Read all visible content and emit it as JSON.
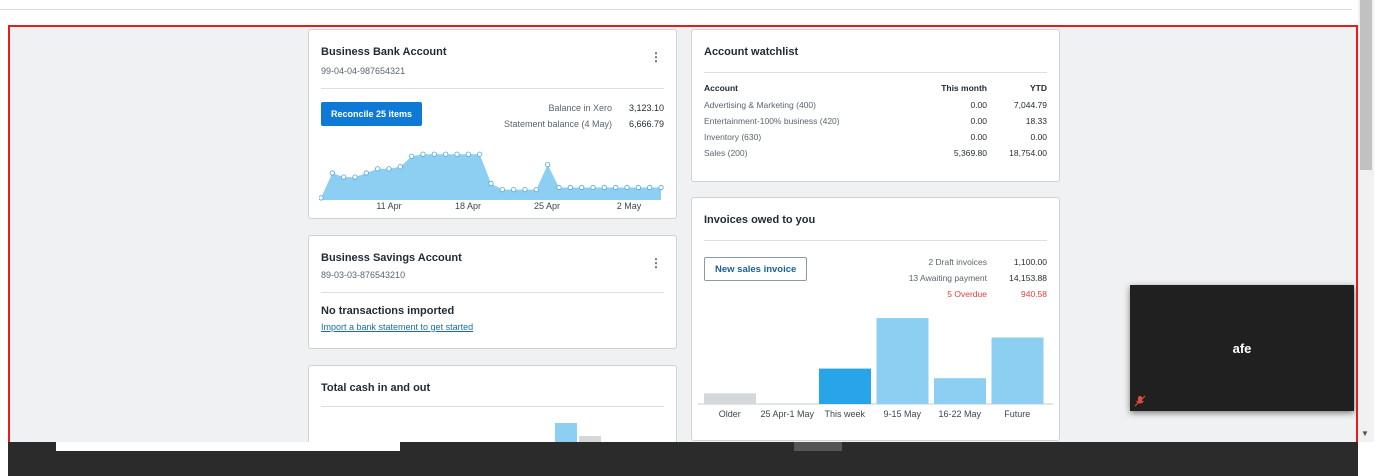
{
  "bank_account": {
    "title": "Business Bank Account",
    "account_number": "99-04-04-987654321",
    "reconcile_label": "Reconcile 25 items",
    "balance_xero_label": "Balance in Xero",
    "balance_xero_value": "3,123.10",
    "statement_label": "Statement balance (4 May)",
    "statement_value": "6,666.79",
    "chart_labels": [
      "11 Apr",
      "18 Apr",
      "25 Apr",
      "2 May"
    ],
    "chart_values": [
      2,
      26,
      22,
      22,
      26,
      30,
      30,
      32,
      42,
      44,
      44,
      44,
      44,
      44,
      44,
      16,
      10,
      10,
      10,
      10,
      34,
      12,
      12,
      12,
      12,
      12,
      12,
      12,
      12,
      12,
      12
    ]
  },
  "savings_account": {
    "title": "Business Savings Account",
    "account_number": "89-03-03-876543210",
    "empty_title": "No transactions imported",
    "empty_link": "Import a bank statement to get started"
  },
  "cash_flow": {
    "title": "Total cash in and out"
  },
  "watchlist": {
    "title": "Account watchlist",
    "columns": [
      "Account",
      "This month",
      "YTD"
    ],
    "rows": [
      {
        "account": "Advertising & Marketing (400)",
        "month": "0.00",
        "ytd": "7,044.79"
      },
      {
        "account": "Entertainment-100% business (420)",
        "month": "0.00",
        "ytd": "18.33"
      },
      {
        "account": "Inventory (630)",
        "month": "0.00",
        "ytd": "0.00"
      },
      {
        "account": "Sales (200)",
        "month": "5,369.80",
        "ytd": "18,754.00"
      }
    ]
  },
  "invoices": {
    "title": "Invoices owed to you",
    "new_invoice_label": "New sales invoice",
    "draft_label": "2 Draft invoices",
    "draft_value": "1,100.00",
    "awaiting_label": "13 Awaiting payment",
    "awaiting_value": "14,153.88",
    "overdue_label": "5 Overdue",
    "overdue_value": "940.58",
    "colors": {
      "older": "#d4d8db",
      "this_week": "#28a4e8",
      "future": "#8ccff2",
      "overdue": "#e0403a"
    },
    "chart_data": {
      "type": "bar",
      "categories": [
        "Older",
        "25 Apr-1 May",
        "This week",
        "9-15 May",
        "16-22 May",
        "Future"
      ],
      "values": [
        10,
        0,
        33,
        80,
        24,
        62
      ],
      "xlabel": "",
      "ylabel": ""
    }
  },
  "video": {
    "name": "afe"
  }
}
